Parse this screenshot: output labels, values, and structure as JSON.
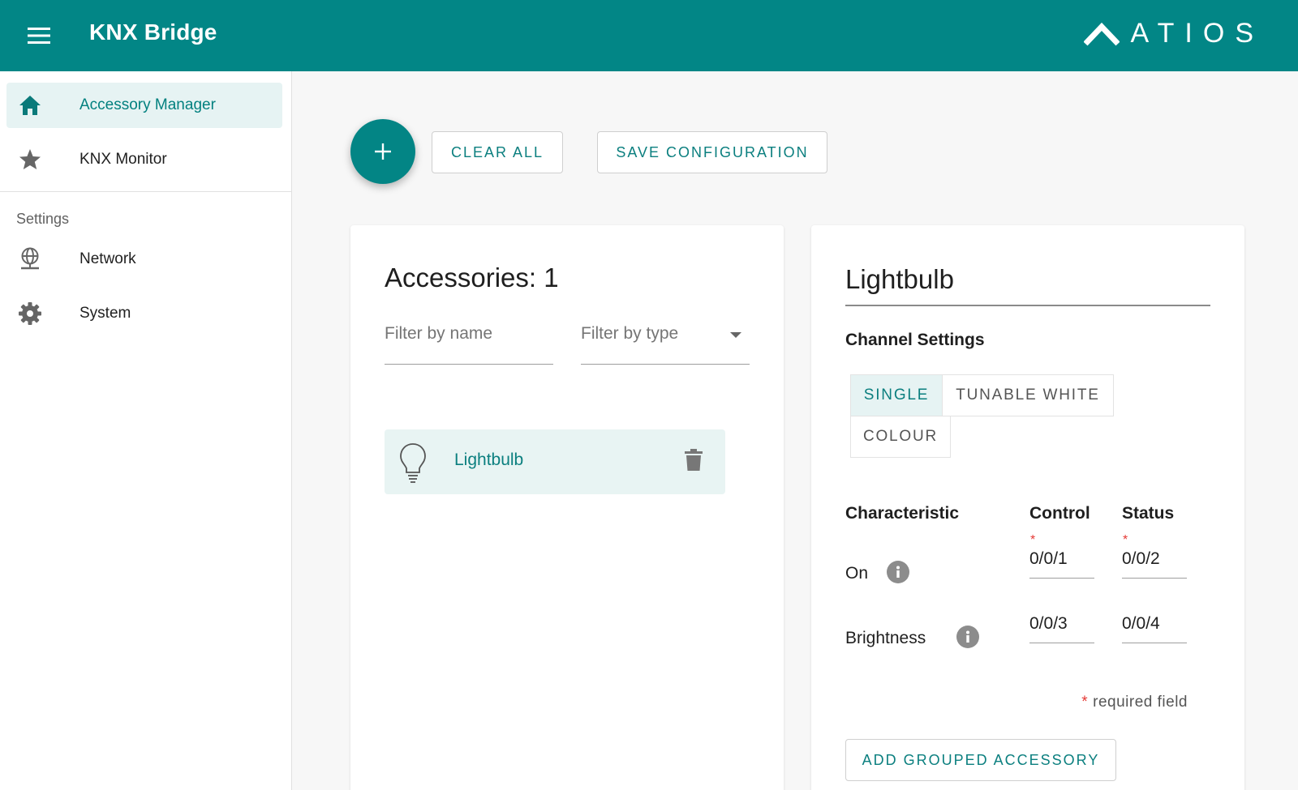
{
  "header": {
    "title": "KNX Bridge",
    "brand": "ATIOS",
    "bg_color": "#028686"
  },
  "sidebar": {
    "items": [
      {
        "label": "Accessory Manager",
        "icon": "home-icon",
        "active": true
      },
      {
        "label": "KNX Monitor",
        "icon": "star-icon"
      }
    ],
    "section_label": "Settings",
    "settings_items": [
      {
        "label": "Network",
        "icon": "network-icon"
      },
      {
        "label": "System",
        "icon": "gear-icon"
      }
    ]
  },
  "toolbar": {
    "add_icon": "plus-icon",
    "clear_label": "CLEAR ALL",
    "save_label": "SAVE CONFIGURATION"
  },
  "accessories": {
    "title": "Accessories: 1",
    "filter_name_placeholder": "Filter by name",
    "filter_type_placeholder": "Filter by type",
    "items": [
      {
        "name": "Lightbulb",
        "icon": "lightbulb-icon"
      }
    ]
  },
  "detail": {
    "title": "Lightbulb",
    "channel_settings_label": "Channel Settings",
    "channel_options": [
      "SINGLE",
      "TUNABLE WHITE",
      "COLOUR"
    ],
    "selected_channel": "SINGLE",
    "columns": {
      "characteristic": "Characteristic",
      "control": "Control",
      "status": "Status"
    },
    "rows": [
      {
        "name": "On",
        "control": "0/0/1",
        "status": "0/0/2",
        "required": true
      },
      {
        "name": "Brightness",
        "control": "0/0/3",
        "status": "0/0/4",
        "required": false
      }
    ],
    "required_marker": "*",
    "required_note": "required field",
    "add_grouped_label": "ADD GROUPED ACCESSORY"
  },
  "colors": {
    "accent": "#0b7f7f",
    "required": "#e53935"
  }
}
